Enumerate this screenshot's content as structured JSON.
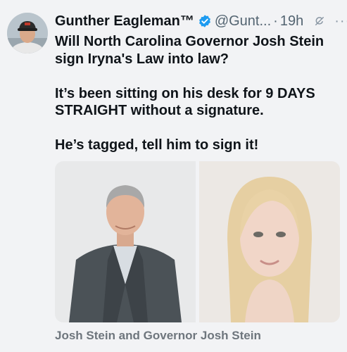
{
  "tweet": {
    "author_name": "Gunther Eagleman™",
    "handle": "@Gunt...",
    "separator": "·",
    "time": "19h",
    "more": "···",
    "paragraphs": [
      "Will North Carolina Governor Josh Stein sign Iryna's Law into law?",
      "It’s been sitting on his desk for 9 DAYS STRAIGHT without a signature.",
      "He’s tagged, tell him to sign it!"
    ],
    "media_caption": "Josh Stein and Governor Josh Stein"
  },
  "colors": {
    "background": "#f2f3f5",
    "text": "#0f1419",
    "secondary": "#536471",
    "verified": "#1d9bf0"
  },
  "icons": {
    "verified": "verified-badge-icon",
    "grok": "grok-icon",
    "more": "more-icon"
  }
}
